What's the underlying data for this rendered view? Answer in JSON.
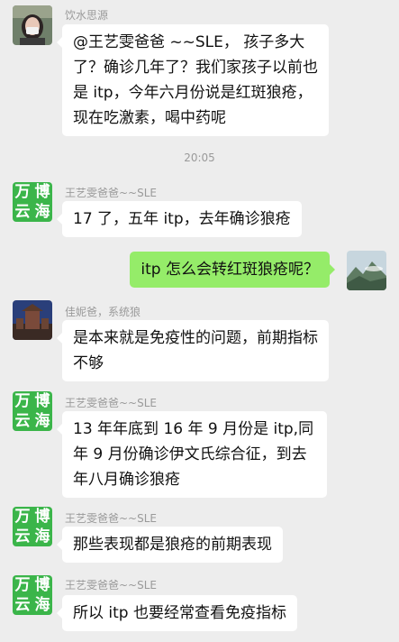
{
  "timestamp": "20:05",
  "logo_chars": [
    "万",
    "博",
    "云",
    "海"
  ],
  "colors": {
    "background": "#ededed",
    "incoming_bubble": "#ffffff",
    "outgoing_bubble": "#95ec69",
    "logo_green": "#3bb54a"
  },
  "messages": [
    {
      "sender": "饮水思源",
      "text": "@王艺雯爸爸 ~~SLE， 孩子多大了？确诊几年了？我们家孩子以前也是 itp，今年六月份说是红斑狼疮，现在吃激素，喝中药呢",
      "direction": "incoming",
      "avatar": "woman-avatar"
    },
    {
      "sender": "王艺雯爸爸~~SLE",
      "text": "17 了，五年 itp，去年确诊狼疮",
      "direction": "incoming",
      "avatar": "wanbo-yunhai-logo"
    },
    {
      "sender": "",
      "text": "itp 怎么会转红斑狼疮呢？",
      "direction": "outgoing",
      "avatar": "landscape-avatar"
    },
    {
      "sender": "佳妮爸，系统狼",
      "text": "是本来就是免疫性的问题，前期指标不够",
      "direction": "incoming",
      "avatar": "building-avatar"
    },
    {
      "sender": "王艺雯爸爸~~SLE",
      "text": "13 年年底到 16 年 9 月份是 itp,同年 9 月份确诊伊文氏综合征，到去年八月确诊狼疮",
      "direction": "incoming",
      "avatar": "wanbo-yunhai-logo"
    },
    {
      "sender": "王艺雯爸爸~~SLE",
      "text": "那些表现都是狼疮的前期表现",
      "direction": "incoming",
      "avatar": "wanbo-yunhai-logo"
    },
    {
      "sender": "王艺雯爸爸~~SLE",
      "text": "所以 itp 也要经常查看免疫指标",
      "direction": "incoming",
      "avatar": "wanbo-yunhai-logo"
    }
  ]
}
